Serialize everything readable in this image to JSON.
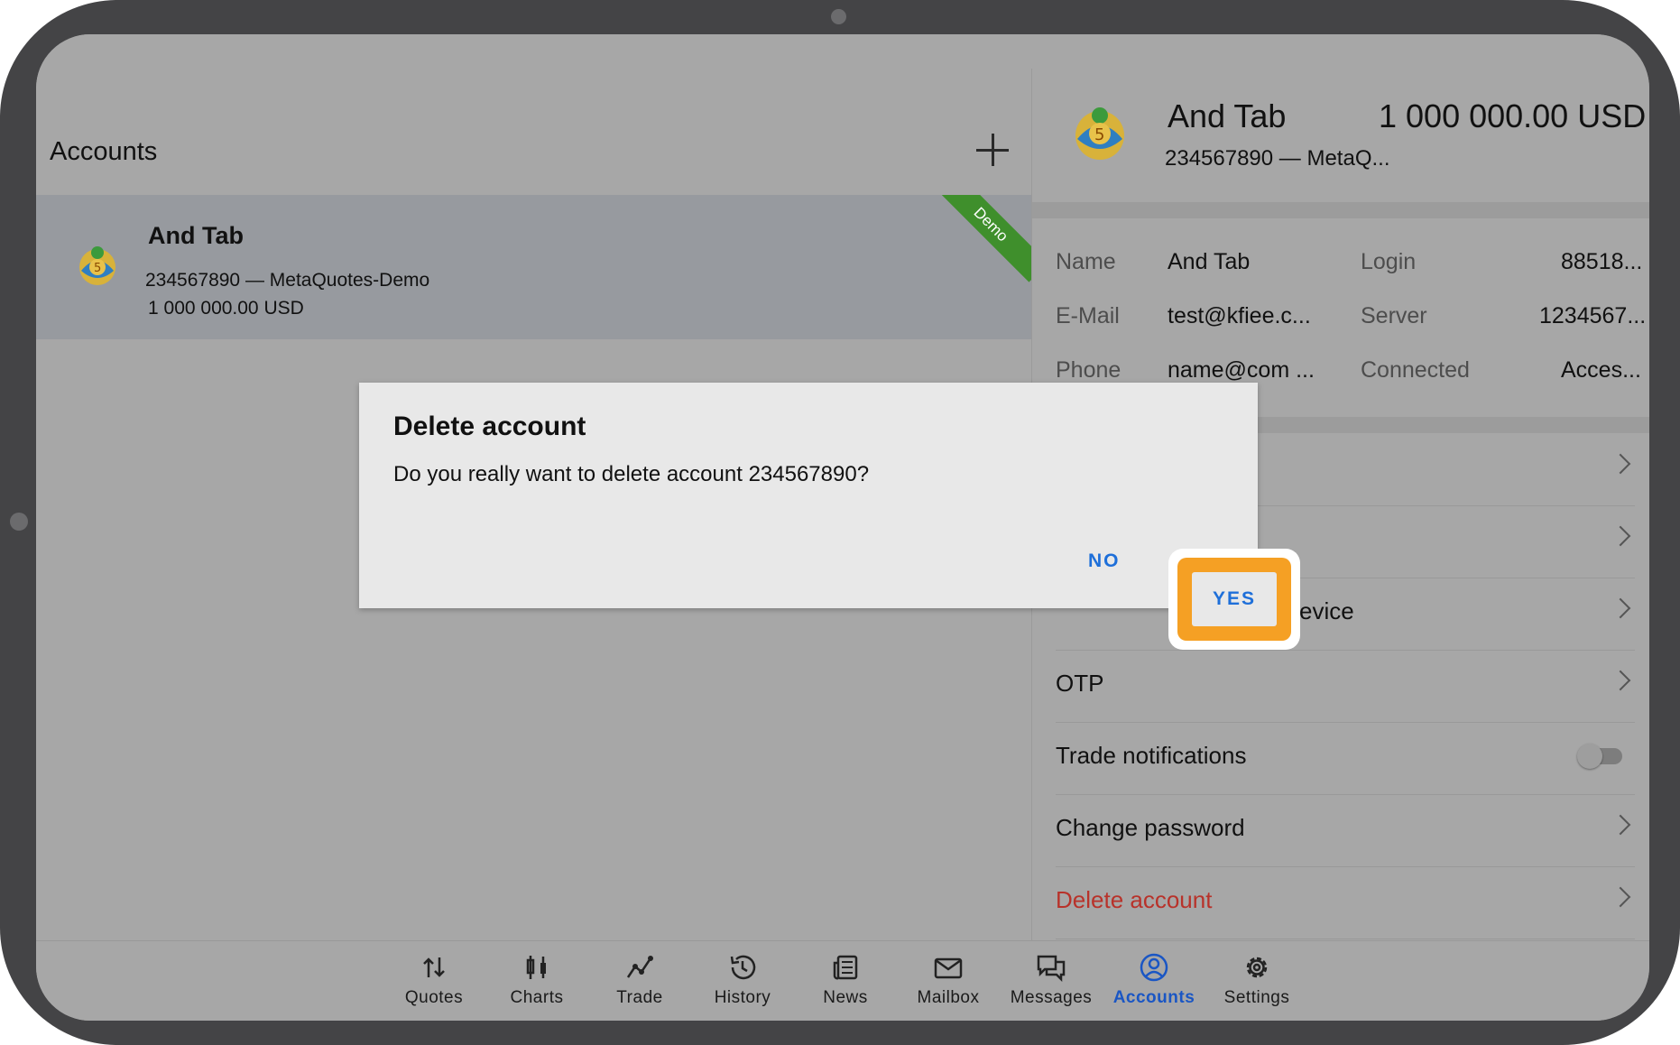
{
  "accounts_panel": {
    "title": "Accounts",
    "item": {
      "name": "And Tab",
      "login_server": "234567890 — MetaQuotes-Demo",
      "balance": "1 000 000.00 USD",
      "badge": "Demo"
    }
  },
  "account_header": {
    "name": "And Tab",
    "balance": "1 000 000.00 USD",
    "subtitle": "234567890 — MetaQ..."
  },
  "account_info": {
    "name_label": "Name",
    "name_value": "And Tab",
    "login_label": "Login",
    "login_value": "88518...",
    "email_label": "E-Mail",
    "email_value": "test@kfiee.c...",
    "server_label": "Server",
    "server_value": "1234567...",
    "phone_label": "Phone",
    "phone_value": "name@com ...",
    "connected_label": "Connected",
    "connected_value": "Acces..."
  },
  "menu": {
    "device_partial": "evice",
    "otp": "OTP",
    "trade_notifications": "Trade notifications",
    "change_password": "Change password",
    "delete_account": "Delete account"
  },
  "dialog": {
    "title": "Delete account",
    "message": "Do you really want to delete account 234567890?",
    "no": "NO",
    "yes": "YES"
  },
  "bottom_nav": {
    "quotes": "Quotes",
    "charts": "Charts",
    "trade": "Trade",
    "history": "History",
    "news": "News",
    "mailbox": "Mailbox",
    "messages": "Messages",
    "accounts": "Accounts",
    "settings": "Settings"
  },
  "colors": {
    "accent": "#1a56c4",
    "danger": "#b8322a",
    "highlight": "#f5a024",
    "demo_badge": "#3f8f2c"
  }
}
